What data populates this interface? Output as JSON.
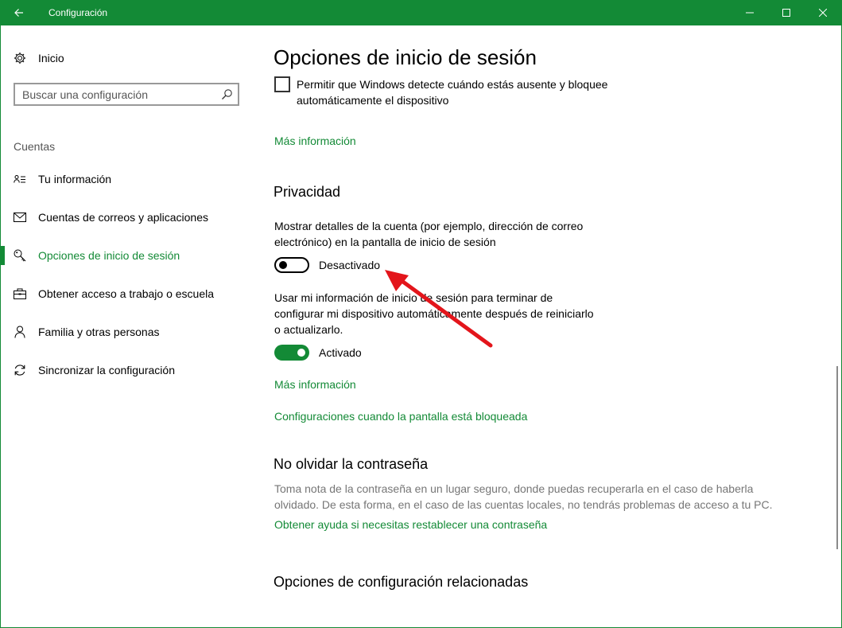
{
  "window": {
    "title": "Configuración",
    "accent_color": "#138a36",
    "back_icon": "back-arrow-icon",
    "minimize_icon": "minimize-icon",
    "maximize_icon": "maximize-icon",
    "close_icon": "close-icon"
  },
  "sidebar": {
    "home_label": "Inicio",
    "home_icon": "gear-icon",
    "search_placeholder": "Buscar una configuración",
    "search_icon": "search-icon",
    "section_label": "Cuentas",
    "items": [
      {
        "label": "Tu información",
        "icon": "contact-card-icon"
      },
      {
        "label": "Cuentas de correos y aplicaciones",
        "icon": "mail-icon"
      },
      {
        "label": "Opciones de inicio de sesión",
        "icon": "key-icon",
        "selected": true
      },
      {
        "label": "Obtener acceso a trabajo o escuela",
        "icon": "briefcase-icon"
      },
      {
        "label": "Familia y otras personas",
        "icon": "person-icon"
      },
      {
        "label": "Sincronizar la configuración",
        "icon": "sync-icon"
      }
    ]
  },
  "main": {
    "title": "Opciones de inicio de sesión",
    "absence_checkbox": {
      "line1": "Permitir que Windows detecte cuándo estás ausente y bloquee",
      "line2": "automáticamente el dispositivo",
      "checked": false
    },
    "more_info_1": "Más información",
    "privacy": {
      "heading": "Privacidad",
      "account_details": {
        "line1": "Mostrar detalles de la cuenta (por ejemplo, dirección de correo",
        "line2": "electrónico) en la pantalla de inicio de sesión",
        "state": "Desactivado"
      },
      "use_signin_info": {
        "line1": "Usar mi información de inicio de sesión para terminar de",
        "line2": "configurar mi dispositivo automáticamente después de reiniciarlo",
        "line3": "o actualizarlo.",
        "state": "Activado"
      },
      "more_info_2": "Más información",
      "lock_screen_link": "Configuraciones cuando la pantalla está bloqueada"
    },
    "password": {
      "heading": "No olvidar la contraseña",
      "line1": "Toma nota de la contraseña en un lugar seguro, donde puedas recuperarla en el caso de haberla",
      "line2": "olvidado. De esta forma, en el caso de las cuentas locales, no tendrás problemas de acceso a tu PC.",
      "help_link": "Obtener ayuda si necesitas restablecer una contraseña"
    },
    "related_heading": "Opciones de configuración relacionadas"
  },
  "annotation_arrow_color": "#e3151b"
}
